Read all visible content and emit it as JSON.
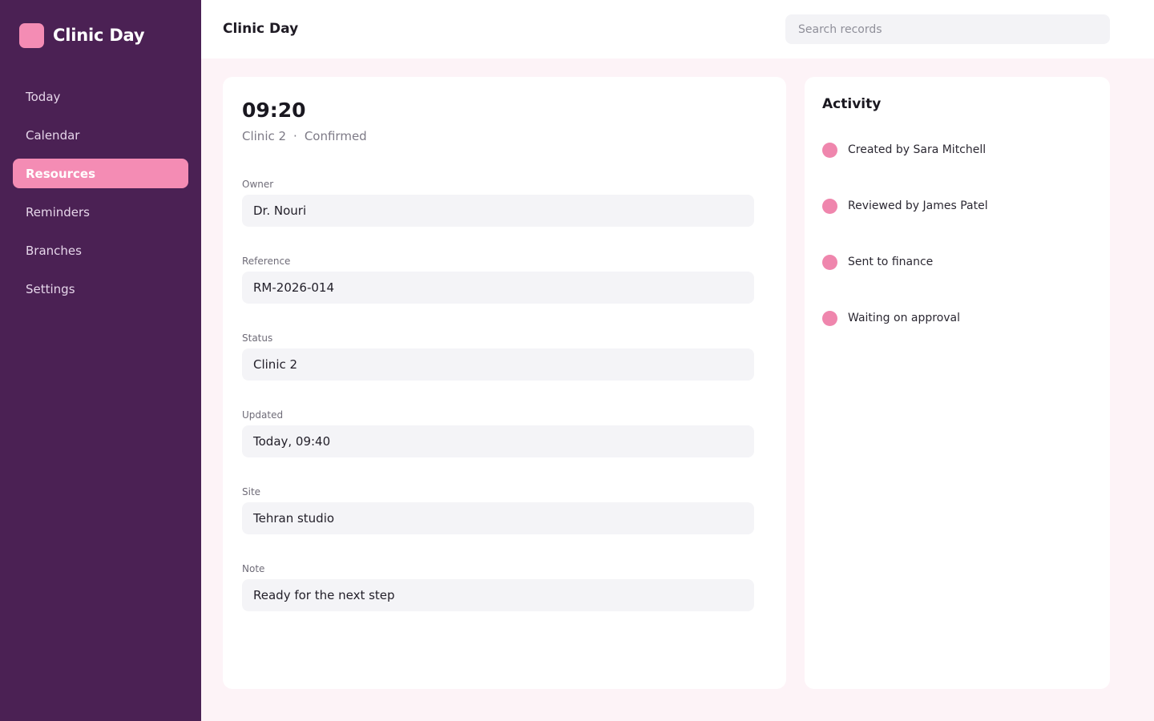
{
  "app": {
    "name": "Clinic Day"
  },
  "sidebar": {
    "items": [
      {
        "label": "Today",
        "active": false
      },
      {
        "label": "Calendar",
        "active": false
      },
      {
        "label": "Resources",
        "active": true
      },
      {
        "label": "Reminders",
        "active": false
      },
      {
        "label": "Branches",
        "active": false
      },
      {
        "label": "Settings",
        "active": false
      }
    ]
  },
  "header": {
    "title": "Clinic Day",
    "search_placeholder": "Search records"
  },
  "detail": {
    "time": "09:20",
    "location": "Clinic 2",
    "separator": "·",
    "state": "Confirmed",
    "fields": [
      {
        "label": "Owner",
        "value": "Dr. Nouri"
      },
      {
        "label": "Reference",
        "value": "RM-2026-014"
      },
      {
        "label": "Status",
        "value": "Clinic 2"
      },
      {
        "label": "Updated",
        "value": "Today, 09:40"
      },
      {
        "label": "Site",
        "value": "Tehran studio"
      },
      {
        "label": "Note",
        "value": "Ready for the next step"
      }
    ]
  },
  "activity": {
    "title": "Activity",
    "items": [
      {
        "text": "Created by Sara Mitchell"
      },
      {
        "text": "Reviewed by James Patel"
      },
      {
        "text": "Sent to finance"
      },
      {
        "text": "Waiting on approval"
      }
    ]
  },
  "colors": {
    "sidebar_bg": "#4b2154",
    "accent": "#f48cb4",
    "page_bg": "#fdf3f7"
  }
}
